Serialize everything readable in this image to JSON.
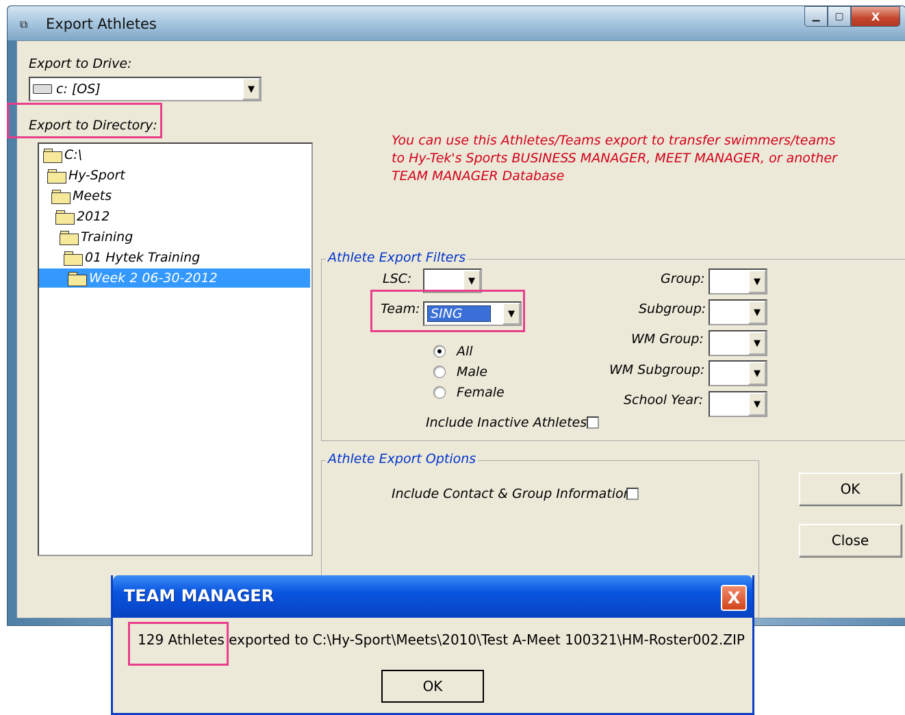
{
  "window": {
    "title": "Export Athletes",
    "minimize": "‗",
    "maximize": "□",
    "close": "X"
  },
  "drive": {
    "label": "Export to Drive:",
    "value": "c: [OS]"
  },
  "directory": {
    "label": "Export to Directory:",
    "items": [
      {
        "label": "C:\\"
      },
      {
        "label": "Hy-Sport"
      },
      {
        "label": "Meets"
      },
      {
        "label": "2012"
      },
      {
        "label": "Training"
      },
      {
        "label": "01 Hytek Training"
      },
      {
        "label": "Week 2 06-30-2012",
        "selected": true
      }
    ]
  },
  "notice": "You can use this Athletes/Teams export to transfer swimmers/teams to Hy-Tek's Sports BUSINESS MANAGER, MEET MANAGER, or another TEAM MANAGER Database",
  "filters": {
    "title": "Athlete Export Filters",
    "lsc_label": "LSC:",
    "team_label": "Team:",
    "team_value": "SING",
    "gender_options": [
      "All",
      "Male",
      "Female"
    ],
    "gender_selected": "All",
    "inactive_label": "Include Inactive Athletes",
    "group_label": "Group:",
    "subgroup_label": "Subgroup:",
    "wm_group_label": "WM Group:",
    "wm_subgroup_label": "WM Subgroup:",
    "school_year_label": "School Year:"
  },
  "options": {
    "title": "Athlete Export Options",
    "contact_label": "Include Contact & Group Information"
  },
  "buttons": {
    "ok": "OK",
    "close": "Close"
  },
  "message": {
    "title": "TEAM MANAGER",
    "close": "X",
    "count": "129 Athletes",
    "rest": " exported to C:\\Hy-Sport\\Meets\\2010\\Test A-Meet 100321\\HM-Roster002.ZIP",
    "ok": "OK"
  }
}
